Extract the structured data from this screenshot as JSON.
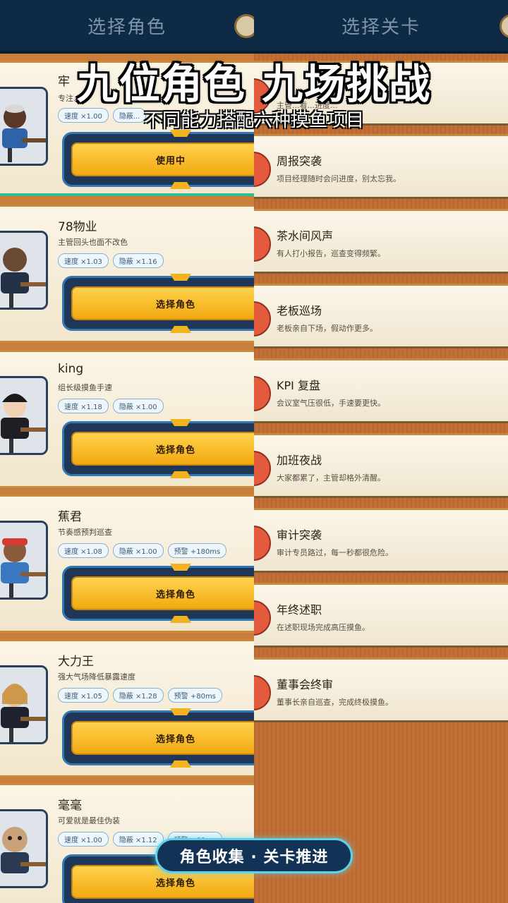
{
  "overlay": {
    "headline": "九位角色  九场挑战",
    "subline": "不同能力搭配六种摸鱼项目",
    "pill": "角色收集 · 关卡推进"
  },
  "left": {
    "title": "选择角色",
    "characters": [
      {
        "name": "牢",
        "desc": "专注...",
        "tags": [
          "速度 ×1.00",
          "隐蔽..."
        ],
        "button": "使用中"
      },
      {
        "name": "78物业",
        "desc": "主管回头也面不改色",
        "tags": [
          "速度 ×1.03",
          "隐蔽 ×1.16"
        ],
        "button": "选择角色"
      },
      {
        "name": "king",
        "desc": "组长级摸鱼手速",
        "tags": [
          "速度 ×1.18",
          "隐蔽 ×1.00"
        ],
        "button": "选择角色"
      },
      {
        "name": "蕉君",
        "desc": "节奏感预判巡查",
        "tags": [
          "速度 ×1.08",
          "隐蔽 ×1.00",
          "预警 +180ms"
        ],
        "button": "选择角色"
      },
      {
        "name": "大力王",
        "desc": "强大气场降低暴露速度",
        "tags": [
          "速度 ×1.05",
          "隐蔽 ×1.28",
          "预警 +80ms"
        ],
        "button": "选择角色"
      },
      {
        "name": "毫毫",
        "desc": "可爱就是最佳伪装",
        "tags": [
          "速度 ×1.00",
          "隐蔽 ×1.12",
          "预警 +60ms"
        ],
        "button": "选择角色"
      }
    ]
  },
  "right": {
    "title": "选择关卡",
    "levels": [
      {
        "title": "",
        "desc": "主管...看...进度..."
      },
      {
        "title": "周报突袭",
        "desc": "项目经理随时会问进度，别太忘我。"
      },
      {
        "title": "茶水间风声",
        "desc": "有人打小报告，巡查变得频繁。"
      },
      {
        "title": "老板巡场",
        "desc": "老板亲自下场，假动作更多。"
      },
      {
        "title": "KPI 复盘",
        "desc": "会议室气压很低，手速要更快。"
      },
      {
        "title": "加班夜战",
        "desc": "大家都累了，主管却格外清醒。"
      },
      {
        "title": "审计突袭",
        "desc": "审计专员路过，每一秒都很危险。"
      },
      {
        "title": "年终述职",
        "desc": "在述职现场完成高压摸鱼。"
      },
      {
        "title": "董事会终审",
        "desc": "董事长亲自巡查，完成终极摸鱼。"
      }
    ]
  },
  "colors": {
    "button_gold": "#f2a911",
    "header_navy": "#0f2a44",
    "level_dot": "#e45a3c",
    "pill_border": "#5fd0e8"
  }
}
